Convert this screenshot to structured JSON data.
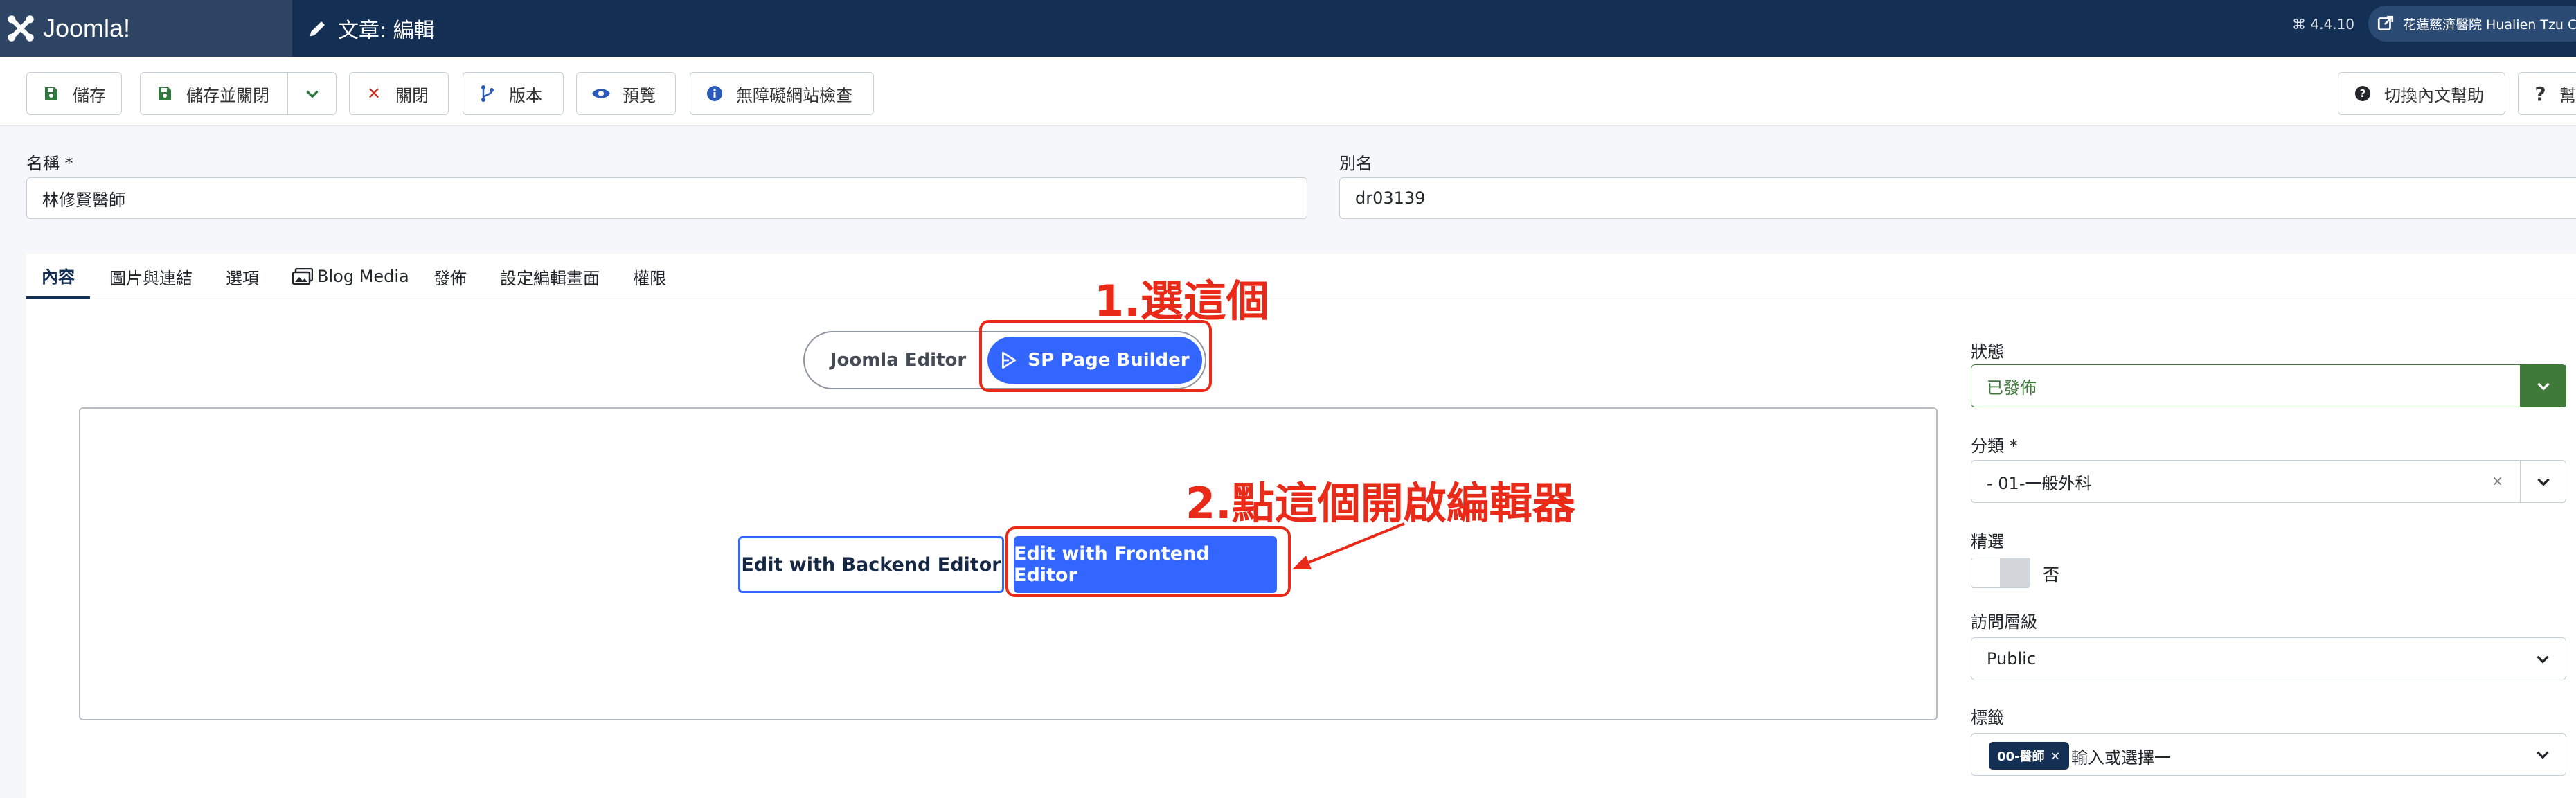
{
  "header": {
    "brand": "Joomla!",
    "title": "文章: 編輯",
    "version": "⌘ 4.4.10",
    "user": "花蓮慈濟醫院 Hualien Tzu Chi"
  },
  "toolbar": {
    "save": "儲存",
    "save_close": "儲存並關閉",
    "close": "關閉",
    "versions": "版本",
    "preview": "預覽",
    "accessibility": "無障礙網站檢查",
    "toggle_help": "切換內文幫助",
    "help": "幫"
  },
  "form": {
    "title_label": "名稱 *",
    "title_value": "林修賢醫師",
    "alias_label": "別名",
    "alias_value": "dr03139"
  },
  "tabs": [
    "內容",
    "圖片與連結",
    "選項",
    "Blog Media",
    "發佈",
    "設定編輯畫面",
    "權限"
  ],
  "editor_switch": {
    "joomla": "Joomla Editor",
    "sp": "SP Page Builder"
  },
  "editor_buttons": {
    "backend": "Edit with Backend Editor",
    "frontend": "Edit with Frontend Editor"
  },
  "annotations": {
    "step1": "1.選這個",
    "step2": "2.點這個開啟編輯器",
    "color": "#ea2a18"
  },
  "sidebar": {
    "status_label": "狀態",
    "status_value": "已發佈",
    "category_label": "分類 *",
    "category_value": "- 01-一般外科",
    "featured_label": "精選",
    "featured_value": "否",
    "access_label": "訪問層級",
    "access_value": "Public",
    "tags_label": "標籤",
    "tag_chip": "00-醫師",
    "tags_placeholder": "輸入或選擇一"
  },
  "colors": {
    "header_bg": "#132f53",
    "accent": "#3366ff",
    "published_green": "#3f7a3a"
  }
}
